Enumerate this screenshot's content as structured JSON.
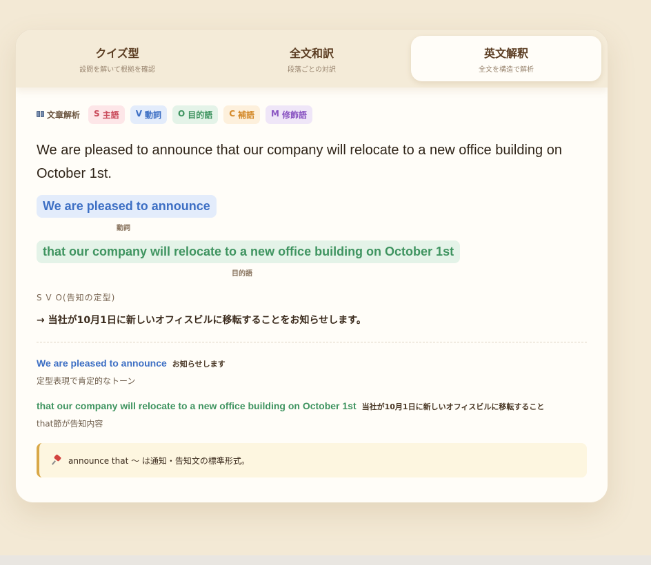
{
  "tabs": [
    {
      "title": "クイズ型",
      "subtitle": "設問を解いて根拠を確認"
    },
    {
      "title": "全文和訳",
      "subtitle": "段落ごとの対訳"
    },
    {
      "title": "英文解釈",
      "subtitle": "全文を構造で解析"
    }
  ],
  "active_tab": 2,
  "legend": {
    "label": "文章解析",
    "icon": "book-icon",
    "chips": [
      {
        "key": "S",
        "label": "主語",
        "color": "#c94a5a"
      },
      {
        "key": "V",
        "label": "動詞",
        "color": "#3d6fc4"
      },
      {
        "key": "O",
        "label": "目的語",
        "color": "#3f9460"
      },
      {
        "key": "C",
        "label": "補語",
        "color": "#d48a2a"
      },
      {
        "key": "M",
        "label": "修飾語",
        "color": "#8a55c2"
      }
    ]
  },
  "sentence": "We are pleased to announce that our company will relocate to a new office building on October 1st.",
  "segments": [
    {
      "text": "We are pleased to announce",
      "role": "動詞"
    },
    {
      "text": "that our company will relocate to a new office building on October 1st",
      "role": "目的語"
    }
  ],
  "pattern": "S V O(告知の定型)",
  "translation": "→ 当社が10月1日に新しいオフィスビルに移転することをお知らせします。",
  "breakdown": [
    {
      "en": "We are pleased to announce",
      "ja": "お知らせします",
      "note": "定型表現で肯定的なトーン"
    },
    {
      "en": "that our company will relocate to a new office building on October 1st",
      "ja": "当社が10月1日に新しいオフィスビルに移転すること",
      "note": "that節が告知内容"
    }
  ],
  "tip": {
    "icon": "pin-icon",
    "text": "announce that 〜 は通知・告知文の標準形式。"
  }
}
